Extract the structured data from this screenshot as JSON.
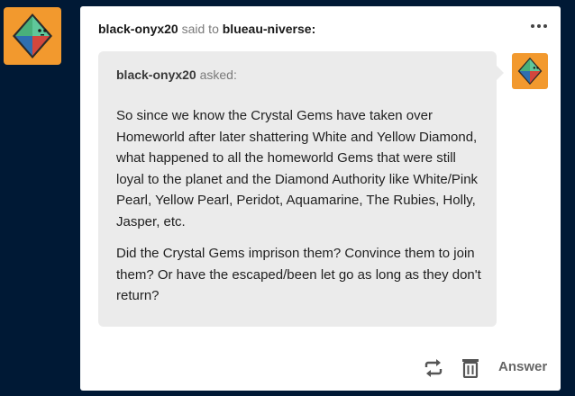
{
  "post": {
    "author": "black-onyx20",
    "said_to": "said to",
    "recipient": "blueau-niverse:",
    "menu_icon": "ellipsis-icon"
  },
  "ask": {
    "asker": "black-onyx20",
    "asked_label": "asked:",
    "paragraphs": [
      "So since we know the Crystal Gems have taken over Homeworld after later shattering White and Yellow Diamond, what happened to all the homeworld Gems that were still loyal to the planet and the Diamond Authority like White/Pink Pearl, Yellow Pearl, Peridot, Aquamarine, The Rubies, Holly, Jasper, etc.",
      "Did the Crystal Gems imprison them? Convince them to join them? Or have the escaped/been let go as long as they don't return?"
    ]
  },
  "footer": {
    "reblog_icon": "reblog-icon",
    "delete_icon": "trash-icon",
    "answer_label": "Answer"
  },
  "colors": {
    "background": "#001935",
    "avatar_bg": "#f2992e",
    "ask_bg": "#ebebeb"
  }
}
